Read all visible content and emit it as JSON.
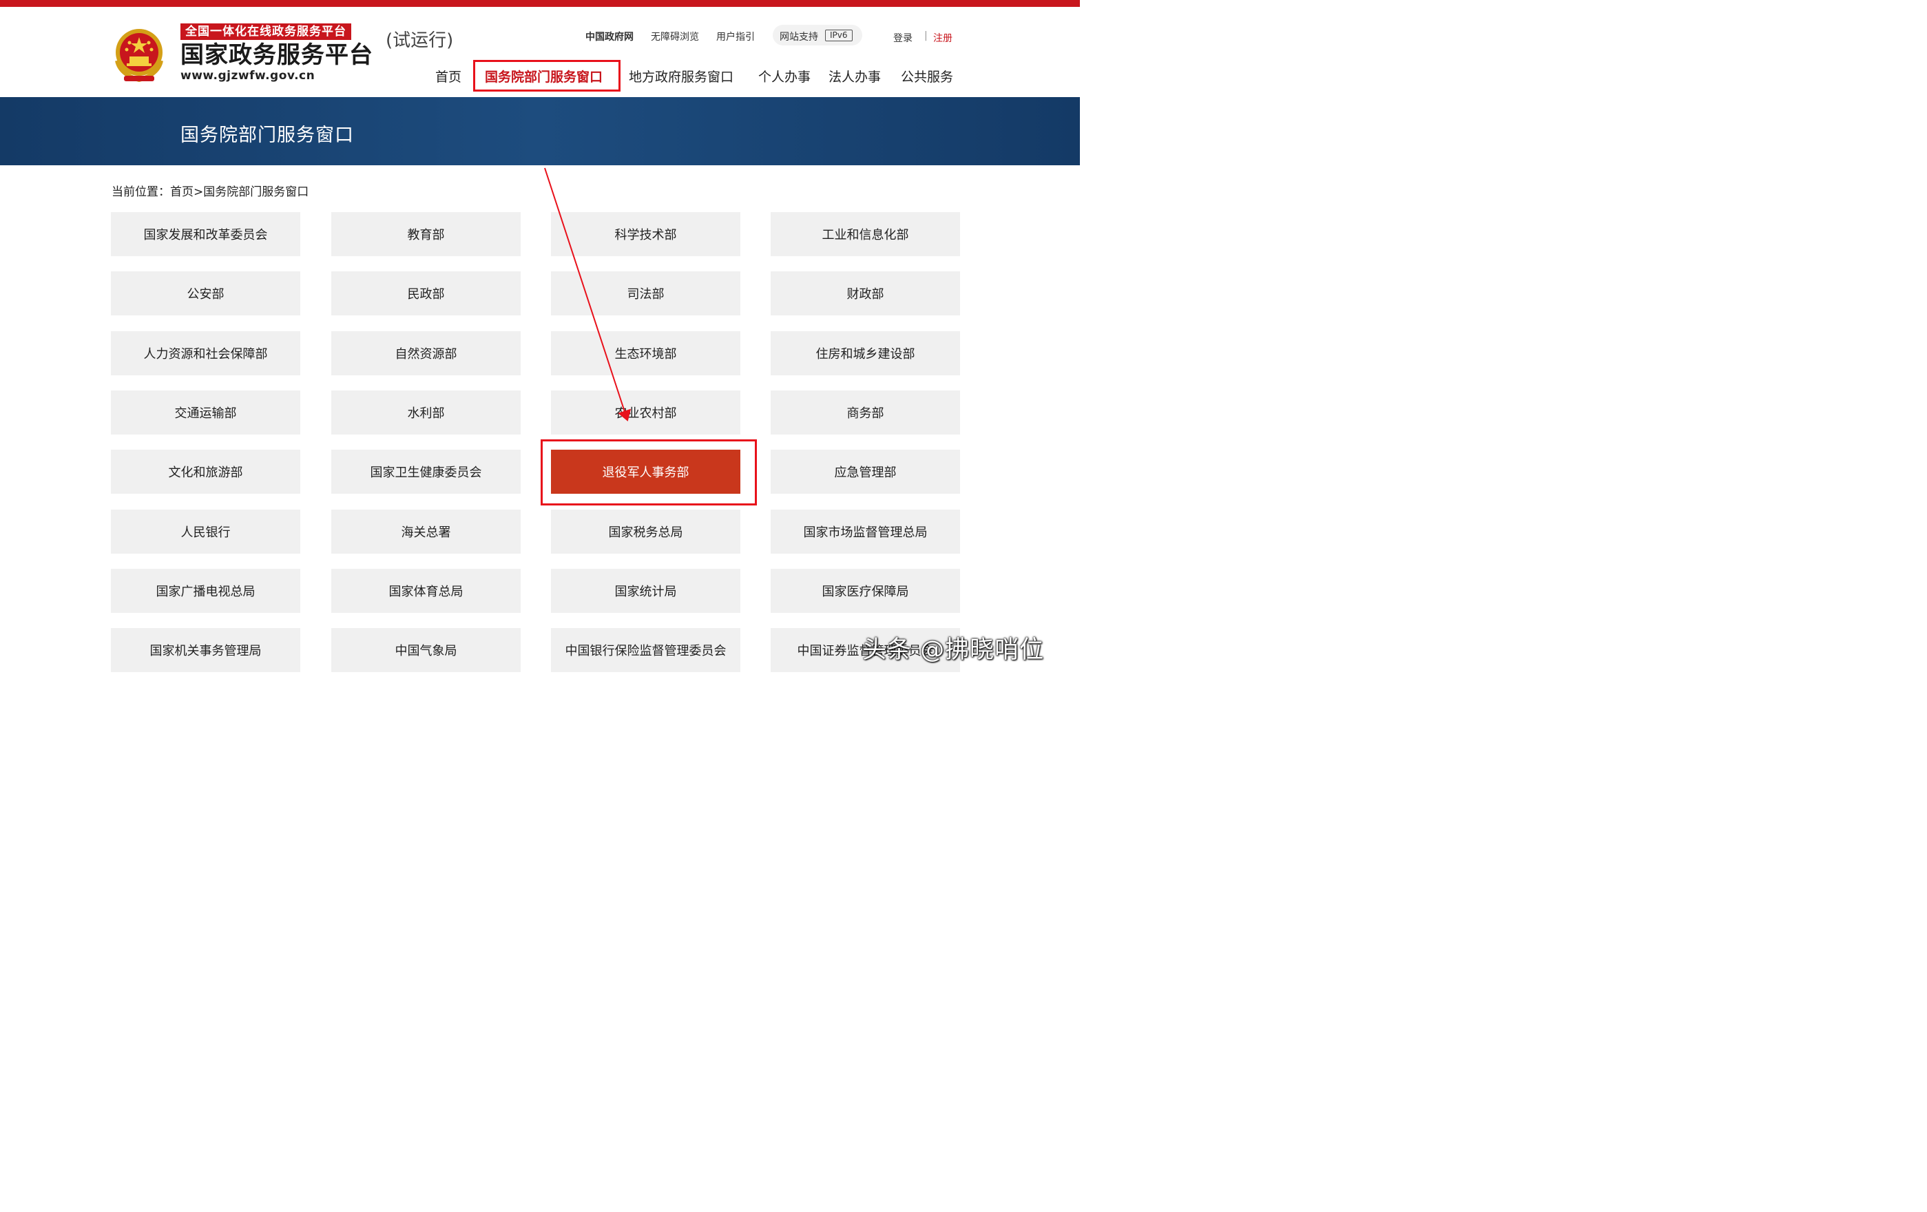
{
  "header": {
    "logo_sub": "全国一体化在线政务服务平台",
    "logo_main": "国家政务服务平台",
    "logo_url": "www.gjzwfw.gov.cn",
    "trial": "(试运行)",
    "utility_links": [
      "中国政府网",
      "无障碍浏览",
      "用户指引"
    ],
    "site_support": "网站支持",
    "ipv6": "IPv6",
    "login": "登录",
    "separator": "|",
    "register": "注册",
    "nav": [
      "首页",
      "国务院部门服务窗口",
      "地方政府服务窗口",
      "个人办事",
      "法人办事",
      "公共服务"
    ],
    "active_nav_index": 1
  },
  "banner": {
    "title": "国务院部门服务窗口"
  },
  "breadcrumb": "当前位置：首页>国务院部门服务窗口",
  "departments": [
    "国家发展和改革委员会",
    "教育部",
    "科学技术部",
    "工业和信息化部",
    "公安部",
    "民政部",
    "司法部",
    "财政部",
    "人力资源和社会保障部",
    "自然资源部",
    "生态环境部",
    "住房和城乡建设部",
    "交通运输部",
    "水利部",
    "农业农村部",
    "商务部",
    "文化和旅游部",
    "国家卫生健康委员会",
    "退役军人事务部",
    "应急管理部",
    "人民银行",
    "海关总署",
    "国家税务总局",
    "国家市场监督管理总局",
    "国家广播电视总局",
    "国家体育总局",
    "国家统计局",
    "国家医疗保障局",
    "国家机关事务管理局",
    "中国气象局",
    "中国银行保险监督管理委员会",
    "中国证券监督管理委员会"
  ],
  "highlighted_department": "退役军人事务部",
  "watermark": "头条 @拂晓哨位",
  "colors": {
    "brand_red": "#c8161d",
    "highlight": "#c9371c",
    "banner_blue": "#1a4674",
    "tile_gray": "#f0f0f0"
  }
}
